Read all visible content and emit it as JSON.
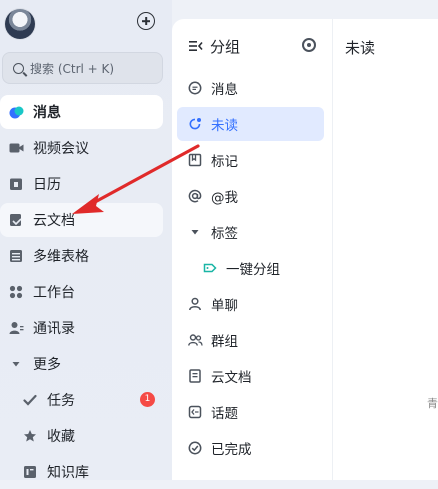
{
  "sidebar": {
    "search_placeholder": "搜索 (Ctrl + K)",
    "items": [
      {
        "label": "消息"
      },
      {
        "label": "视频会议"
      },
      {
        "label": "日历"
      },
      {
        "label": "云文档"
      },
      {
        "label": "多维表格"
      },
      {
        "label": "工作台"
      },
      {
        "label": "通讯录"
      },
      {
        "label": "更多"
      },
      {
        "label": "任务",
        "badge": "1"
      },
      {
        "label": "收藏"
      },
      {
        "label": "知识库"
      }
    ]
  },
  "groups_panel": {
    "title": "分组",
    "items": [
      {
        "label": "消息"
      },
      {
        "label": "未读"
      },
      {
        "label": "标记"
      },
      {
        "label": "@我"
      },
      {
        "label": "标签"
      },
      {
        "label": "一键分组"
      },
      {
        "label": "单聊"
      },
      {
        "label": "群组"
      },
      {
        "label": "云文档"
      },
      {
        "label": "话题"
      },
      {
        "label": "已完成"
      }
    ]
  },
  "content_panel": {
    "title": "未读",
    "edge_text": "青"
  },
  "colors": {
    "accent": "#3370ff",
    "arrow": "#e02a2a",
    "badge": "#f54a45"
  }
}
